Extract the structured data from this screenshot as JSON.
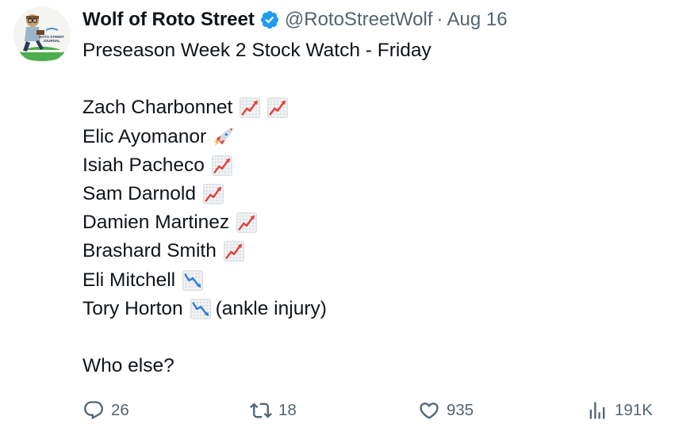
{
  "author": {
    "name": "Wolf of Roto Street",
    "handle": "@RotoStreetWolf",
    "separator": "·",
    "date": "Aug 16",
    "avatar_logo_text": "ROTO STREET JOURNAL"
  },
  "tweet": {
    "title": "Preseason Week 2 Stock Watch - Friday",
    "players": [
      {
        "name": "Zach Charbonnet",
        "icons": [
          "chart-increasing-icon",
          "chart-increasing-icon"
        ],
        "note": ""
      },
      {
        "name": "Elic Ayomanor",
        "icons": [
          "rocket-icon"
        ],
        "note": ""
      },
      {
        "name": "Isiah Pacheco",
        "icons": [
          "chart-increasing-icon"
        ],
        "note": ""
      },
      {
        "name": "Sam Darnold",
        "icons": [
          "chart-increasing-icon"
        ],
        "note": ""
      },
      {
        "name": "Damien Martinez",
        "icons": [
          "chart-increasing-icon"
        ],
        "note": ""
      },
      {
        "name": "Brashard Smith",
        "icons": [
          "chart-increasing-icon"
        ],
        "note": ""
      },
      {
        "name": "Eli Mitchell",
        "icons": [
          "chart-decreasing-icon"
        ],
        "note": ""
      },
      {
        "name": "Tory Horton",
        "icons": [
          "chart-decreasing-icon"
        ],
        "note": "(ankle injury)"
      }
    ],
    "closing": "Who else?"
  },
  "actions": {
    "replies": "26",
    "retweets": "18",
    "likes": "935",
    "views": "191K"
  },
  "colors": {
    "verified": "#1d9bf0",
    "text": "#0f1419",
    "secondary": "#536471",
    "chart_up": "#e0413a",
    "chart_down": "#2f7fd8"
  }
}
